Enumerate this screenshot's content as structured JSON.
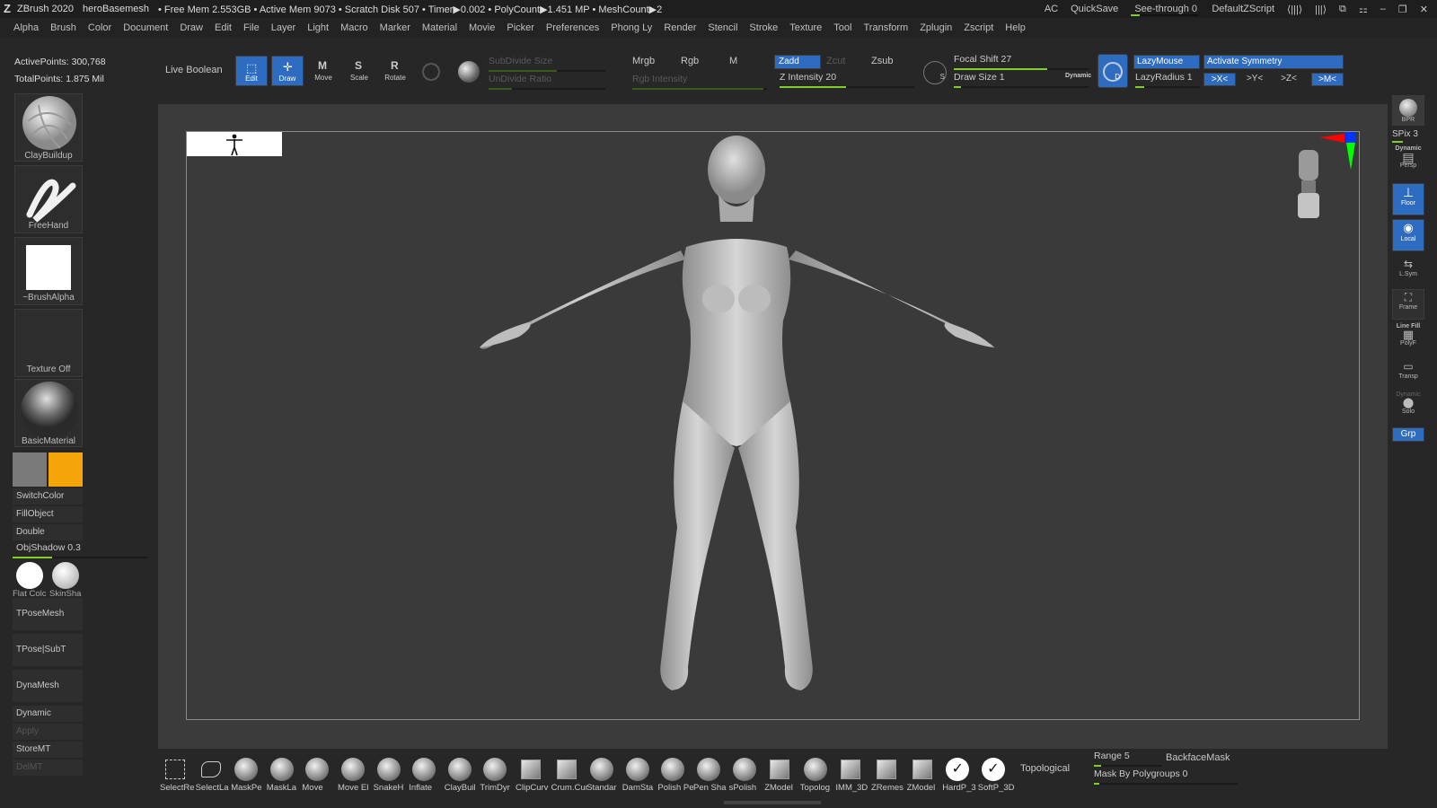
{
  "titlebar": {
    "app": "ZBrush 2020",
    "doc": "heroBasemesh",
    "stats": "• Free Mem 2.553GB • Active Mem 9073 • Scratch Disk 507 • Timer▶0.002 • PolyCount▶1.451 MP • MeshCount▶2",
    "ac": "AC",
    "quicksave": "QuickSave",
    "seethrough": "See-through 0",
    "script": "DefaultZScript"
  },
  "menu": [
    "Alpha",
    "Brush",
    "Color",
    "Document",
    "Draw",
    "Edit",
    "File",
    "Layer",
    "Light",
    "Macro",
    "Marker",
    "Material",
    "Movie",
    "Picker",
    "Preferences",
    "Phong Ly",
    "Render",
    "Stencil",
    "Stroke",
    "Texture",
    "Tool",
    "Transform",
    "Zplugin",
    "Zscript",
    "Help"
  ],
  "left": {
    "active_points": "ActivePoints: 300,768",
    "total_points": "TotalPoints: 1.875 Mil",
    "brush": "ClayBuildup",
    "stroke": "FreeHand",
    "alpha": "~BrushAlpha",
    "texture": "Texture Off",
    "material": "BasicMaterial",
    "switch_color": "SwitchColor",
    "fill_object": "FillObject",
    "double": "Double",
    "obj_shadow": "ObjShadow",
    "obj_shadow_value": "0.3",
    "flat_color": "Flat Colc",
    "skin_shade": "SkinSha",
    "tpose_mesh": "TPoseMesh",
    "tpose_subt": "TPose|SubT",
    "dynamesh": "DynaMesh",
    "dynamic": "Dynamic",
    "apply": "Apply",
    "storemt": "StoreMT",
    "delmt": "DelMT",
    "colors": {
      "secondary": "#7a7a7a",
      "primary": "#f5a40a"
    }
  },
  "shelf": {
    "live_boolean": "Live Boolean",
    "edit": "Edit",
    "draw": "Draw",
    "move": "Move",
    "scale": "Scale",
    "rotate": "Rotate",
    "subdivide_size": "SubDivide Size",
    "undivide_ratio": "UnDivide Ratio",
    "mrgb": "Mrgb",
    "rgb": "Rgb",
    "m": "M",
    "rgb_intensity": "Rgb Intensity",
    "zadd": "Zadd",
    "zcut": "Zcut",
    "zsub": "Zsub",
    "z_intensity": "Z Intensity 20",
    "focal_shift": "Focal Shift 27",
    "draw_size": "Draw Size 1",
    "dynamic": "Dynamic",
    "lazymouse": "LazyMouse",
    "lazyradius": "LazyRadius 1",
    "activate_symmetry": "Activate Symmetry",
    "sym_x": ">X<",
    "sym_y": ">Y<",
    "sym_z": ">Z<",
    "sym_m": ">M<"
  },
  "right": {
    "bpr": "BPR",
    "spix": "SPix 3",
    "persp": "Persp",
    "dynamic_label": "Dynamic",
    "floor": "Floor",
    "local": "Local",
    "lsym": "L.Sym",
    "frame": "Frame",
    "linefill": "Line Fill",
    "polyf": "PolyF",
    "transp": "Transp",
    "dynamic2": "Dynamic",
    "solo": "Solo",
    "grp": "Grp"
  },
  "bottom": {
    "brushes": [
      "SelectRe",
      "SelectLa",
      "MaskPe",
      "MaskLa",
      "Move",
      "Move El",
      "SnakeH",
      "Inflate",
      "ClayBuil",
      "TrimDyr",
      "ClipCurv",
      "Crum.Cur",
      "Standar",
      "DamSta",
      "Polish Pen A",
      "Pen Sha",
      "sPolish",
      "ZModel",
      "Topolog",
      "IMM_3D",
      "ZRemes",
      "ZModel",
      "HardP_3",
      "SoftP_3D"
    ],
    "topological": "Topological",
    "range": "Range 5",
    "backface_mask": "BackfaceMask",
    "mask_by_polygroups": "Mask By Polygroups 0"
  }
}
